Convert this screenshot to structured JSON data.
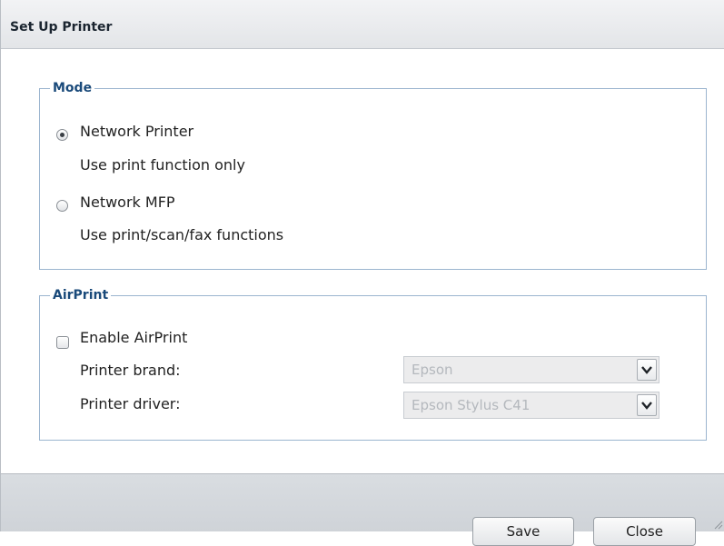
{
  "dialog": {
    "title": "Set Up Printer",
    "mode": {
      "legend": "Mode",
      "options": [
        {
          "label": "Network Printer",
          "description": "Use print function only",
          "selected": true
        },
        {
          "label": "Network MFP",
          "description": "Use print/scan/fax functions",
          "selected": false
        }
      ]
    },
    "airprint": {
      "legend": "AirPrint",
      "enable_label": "Enable AirPrint",
      "enabled": false,
      "brand_label": "Printer brand:",
      "brand_value": "Epson",
      "driver_label": "Printer driver:",
      "driver_value": "Epson Stylus C41"
    },
    "buttons": {
      "save": "Save",
      "close": "Close"
    }
  },
  "icons": {
    "dropdown": "chevron-down-icon",
    "resize": "resize-grip-icon"
  },
  "colors": {
    "legend": "#1a4a7a",
    "fieldset_border": "#9bb5cf",
    "footer_bg": "#d3d7dc"
  }
}
